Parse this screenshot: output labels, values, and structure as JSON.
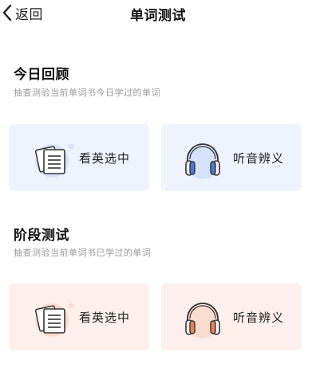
{
  "nav": {
    "back_label": "返回",
    "title": "单词测试"
  },
  "colors": {
    "blue_card": "#eef3fd",
    "orange_card": "#fdf0ec",
    "blue_accent": "#4a78d6",
    "orange_accent": "#e9835a"
  },
  "sections": [
    {
      "title": "今日回顾",
      "subtitle": "抽查测验当前单词书今日学过的单词",
      "cards": [
        {
          "icon": "document-icon",
          "label": "看英选中"
        },
        {
          "icon": "headphones-icon",
          "label": "听音辨义"
        }
      ]
    },
    {
      "title": "阶段测试",
      "subtitle": "抽查测验当前单词书已学过的单词",
      "cards": [
        {
          "icon": "document-icon",
          "label": "看英选中"
        },
        {
          "icon": "headphones-icon",
          "label": "听音辨义"
        }
      ]
    }
  ]
}
